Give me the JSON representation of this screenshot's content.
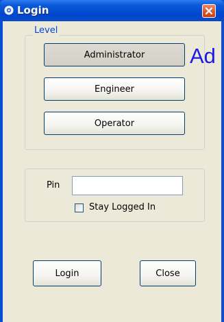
{
  "window": {
    "title": "Login",
    "close_glyph": "✕",
    "icon": "gear-icon",
    "colors": {
      "titlebar": "#0a4fd0",
      "client": "#ece9d8",
      "legend": "#0046d5",
      "close": "#d8552b"
    }
  },
  "level_group": {
    "legend": "Level",
    "buttons": [
      "Administrator",
      "Engineer",
      "Operator"
    ],
    "selected": "Administrator"
  },
  "overlay_text": "Ad",
  "pin_group": {
    "pin_label": "Pin",
    "pin_value": "",
    "stay_logged_in_label": "Stay Logged In",
    "stay_logged_in_checked": false
  },
  "footer": {
    "login_label": "Login",
    "close_label": "Close"
  }
}
